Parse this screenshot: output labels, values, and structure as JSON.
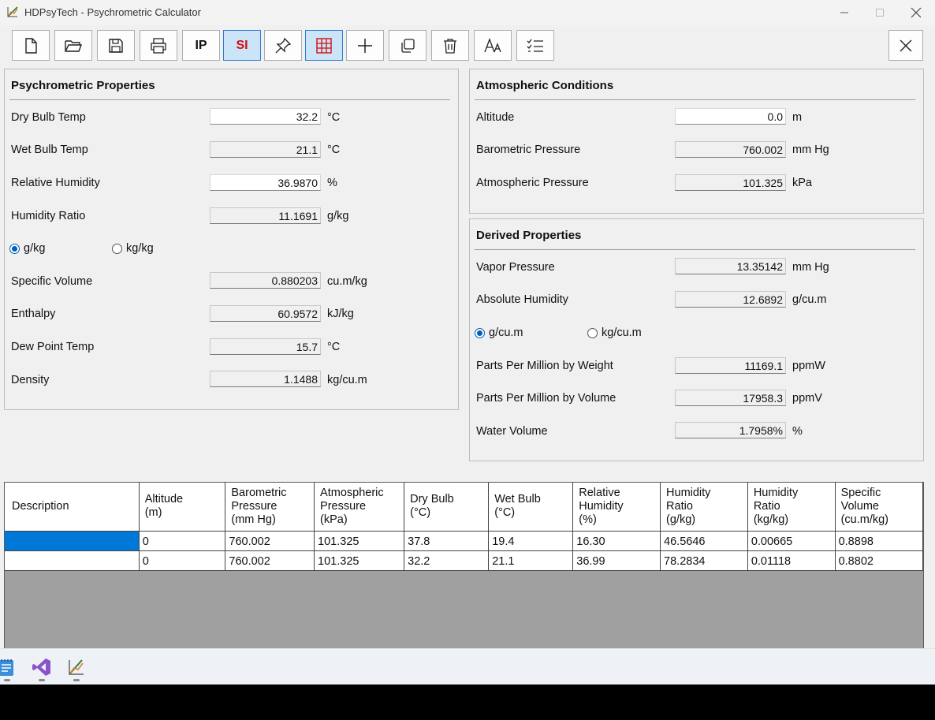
{
  "window": {
    "title": "HDPsyTech - Psychrometric Calculator"
  },
  "toolbar": {
    "buttons": [
      {
        "name": "new",
        "icon": "new-file-icon"
      },
      {
        "name": "open",
        "icon": "open-folder-icon"
      },
      {
        "name": "save",
        "icon": "save-icon"
      },
      {
        "name": "print",
        "icon": "print-icon"
      },
      {
        "name": "ip",
        "label": "IP"
      },
      {
        "name": "si",
        "label": "SI"
      },
      {
        "name": "pin",
        "icon": "pin-icon"
      },
      {
        "name": "grid",
        "icon": "grid-icon"
      },
      {
        "name": "add",
        "icon": "plus-icon"
      },
      {
        "name": "copy",
        "icon": "copy-icon"
      },
      {
        "name": "delete",
        "icon": "trash-icon"
      },
      {
        "name": "font",
        "icon": "font-icon"
      },
      {
        "name": "checklist",
        "icon": "checklist-icon"
      },
      {
        "name": "close",
        "icon": "close-icon"
      }
    ],
    "ip_label": "IP",
    "si_label": "SI"
  },
  "psychrometric": {
    "title": "Psychrometric Properties",
    "dry_bulb": {
      "label": "Dry Bulb Temp",
      "value": "32.2",
      "unit": "°C"
    },
    "wet_bulb": {
      "label": "Wet Bulb Temp",
      "value": "21.1",
      "unit": "°C"
    },
    "rh": {
      "label": "Relative Humidity",
      "value": "36.9870",
      "unit": "%"
    },
    "hum_ratio": {
      "label": "Humidity Ratio",
      "value": "11.1691",
      "unit": "g/kg"
    },
    "radio_gkg": "g/kg",
    "radio_kgkg": "kg/kg",
    "spec_vol": {
      "label": "Specific Volume",
      "value": "0.880203",
      "unit": "cu.m/kg"
    },
    "enthalpy": {
      "label": "Enthalpy",
      "value": "60.9572",
      "unit": "kJ/kg"
    },
    "dew_point": {
      "label": "Dew Point Temp",
      "value": "15.7",
      "unit": "°C"
    },
    "density": {
      "label": "Density",
      "value": "1.1488",
      "unit": "kg/cu.m"
    }
  },
  "atmospheric": {
    "title": "Atmospheric Conditions",
    "altitude": {
      "label": "Altitude",
      "value": "0.0",
      "unit": "m"
    },
    "baro": {
      "label": "Barometric Pressure",
      "value": "760.002",
      "unit": "mm Hg"
    },
    "atm": {
      "label": "Atmospheric Pressure",
      "value": "101.325",
      "unit": "kPa"
    }
  },
  "derived": {
    "title": "Derived Properties",
    "vapor": {
      "label": "Vapor Pressure",
      "value": "13.35142",
      "unit": "mm Hg"
    },
    "abs_hum": {
      "label": "Absolute Humidity",
      "value": "12.6892",
      "unit": "g/cu.m"
    },
    "radio_gcum": "g/cu.m",
    "radio_kgcum": "kg/cu.m",
    "ppmw": {
      "label": "Parts Per Million by Weight",
      "value": "11169.1",
      "unit": "ppmW"
    },
    "ppmv": {
      "label": "Parts Per Million by Volume",
      "value": "17958.3",
      "unit": "ppmV"
    },
    "water_vol": {
      "label": "Water Volume",
      "value": "1.7958%",
      "unit": "%"
    }
  },
  "table": {
    "columns": [
      "Description",
      "Altitude\n(m)",
      "Barometric\nPressure\n(mm Hg)",
      "Atmospheric\nPressure\n(kPa)",
      "Dry Bulb\n(°C)",
      "Wet Bulb\n(°C)",
      "Relative\nHumidity\n(%)",
      "Humidity\nRatio\n(g/kg)",
      "Humidity\nRatio\n(kg/kg)",
      "Specific\nVolume\n(cu.m/kg)"
    ],
    "rows": [
      [
        "",
        "0",
        "760.002",
        "101.325",
        "37.8",
        "19.4",
        "16.30",
        "46.5646",
        "0.00665",
        "0.8898"
      ],
      [
        "",
        "0",
        "760.002",
        "101.325",
        "32.2",
        "21.1",
        "36.99",
        "78.2834",
        "0.01118",
        "0.8802"
      ]
    ]
  },
  "taskbar": {
    "apps": [
      {
        "name": "notepad",
        "icon": "notepad-icon"
      },
      {
        "name": "visual-studio",
        "icon": "visual-studio-icon"
      },
      {
        "name": "hdpsytech",
        "icon": "psychrometric-app-icon"
      }
    ]
  }
}
